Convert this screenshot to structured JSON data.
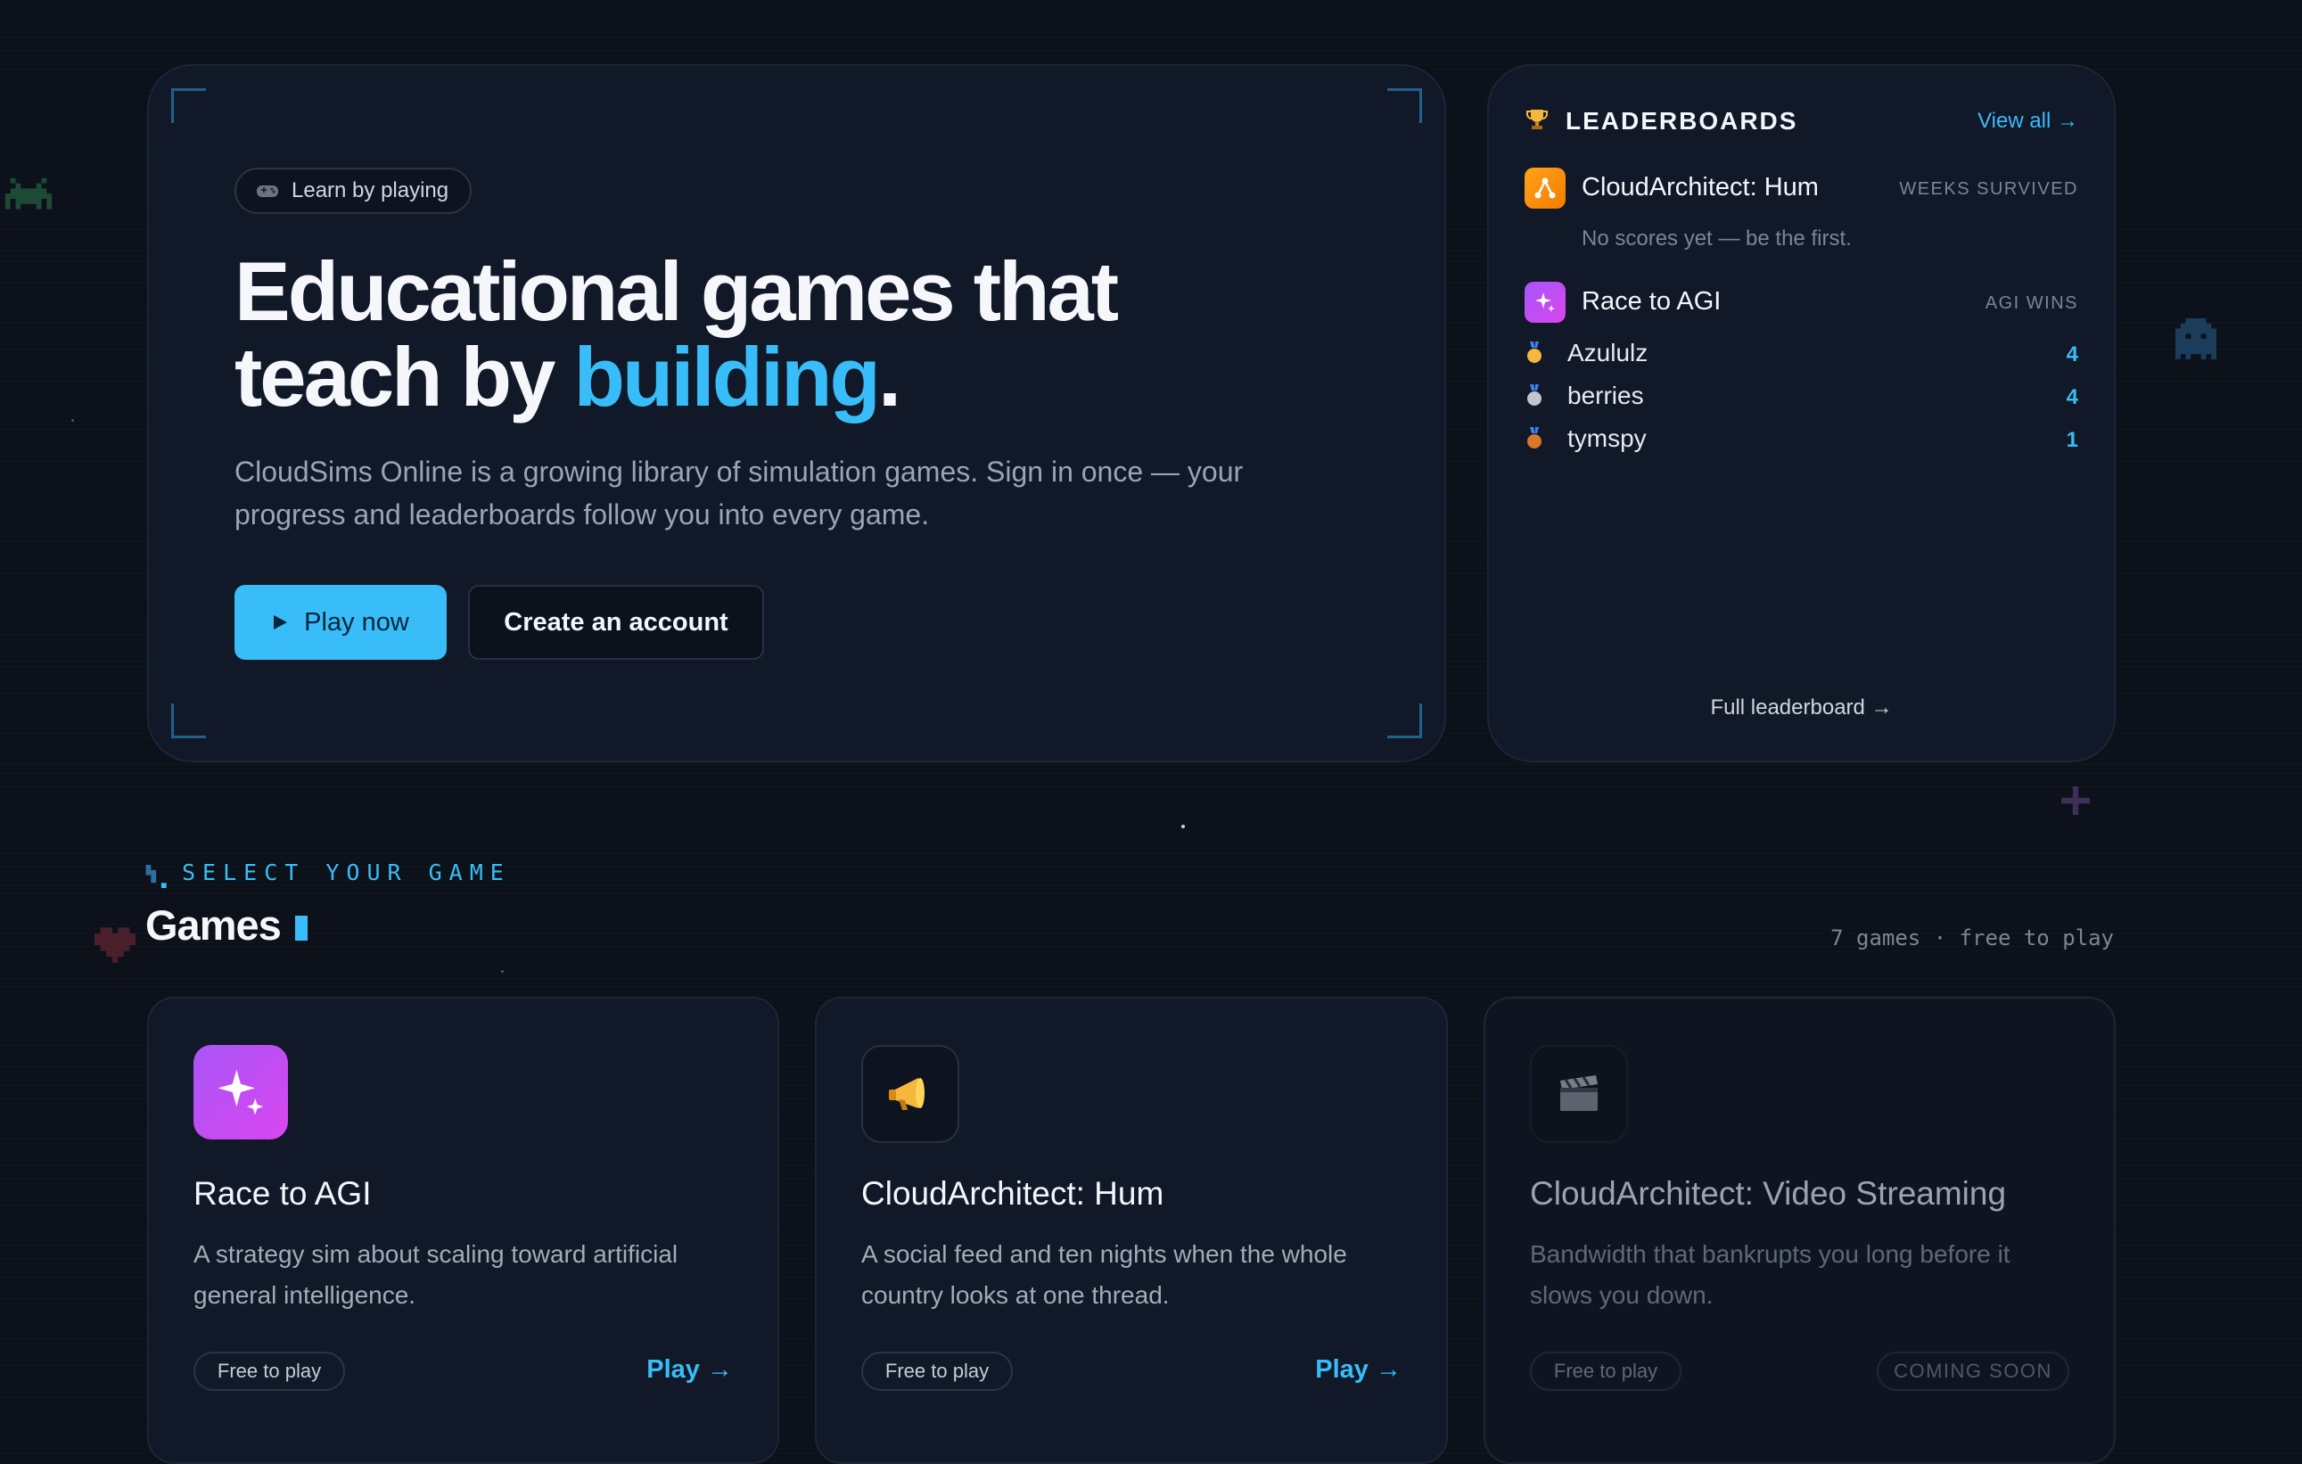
{
  "hero": {
    "badge": "Learn by playing",
    "title_line1": "Educational games that",
    "title_line2_prefix": "teach by ",
    "title_highlight": "building",
    "title_suffix": ".",
    "description_line1": "CloudSims Online is a growing library of simulation games. Sign in once — your",
    "description_line2": "progress and leaderboards follow you into every game.",
    "play_button": "Play now",
    "account_button": "Create an account"
  },
  "leaderboards": {
    "heading": "LEADERBOARDS",
    "view_all": "View all →",
    "games": [
      {
        "name": "CloudArchitect: Hum",
        "metric": "WEEKS SURVIVED",
        "empty_message": "No scores yet — be the first."
      },
      {
        "name": "Race to AGI",
        "metric": "AGI WINS",
        "entries": [
          {
            "player": "Azululz",
            "score": "4"
          },
          {
            "player": "berries",
            "score": "4"
          },
          {
            "player": "tymspy",
            "score": "1"
          }
        ]
      }
    ],
    "full_leaderboard": "Full leaderboard →"
  },
  "games_section": {
    "eyebrow": "SELECT YOUR GAME",
    "heading": "Games",
    "count_text": "7 games · free to play",
    "cards": [
      {
        "title": "Race to AGI",
        "desc_line1": "A strategy sim about scaling toward artificial",
        "desc_line2": "general intelligence.",
        "tag": "Free to play",
        "action": "Play →"
      },
      {
        "title": "CloudArchitect: Hum",
        "desc_line1": "A social feed and ten nights when the whole",
        "desc_line2": "country looks at one thread.",
        "tag": "Free to play",
        "action": "Play →"
      },
      {
        "title": "CloudArchitect: Video Streaming",
        "desc_line1": "Bandwidth that bankrupts you long before it",
        "desc_line2": "slows you down.",
        "tag": "Free to play",
        "action": "COMING SOON"
      }
    ]
  },
  "colors": {
    "accent": "#38bdf8",
    "background": "#0b1019",
    "panel": "#111827"
  },
  "icons": [
    "gamepad-icon",
    "trophy-icon",
    "network-icon",
    "sparkle-icon",
    "gold-medal-icon",
    "silver-medal-icon",
    "bronze-medal-icon",
    "megaphone-icon",
    "clapper-icon",
    "play-triangle-icon"
  ]
}
